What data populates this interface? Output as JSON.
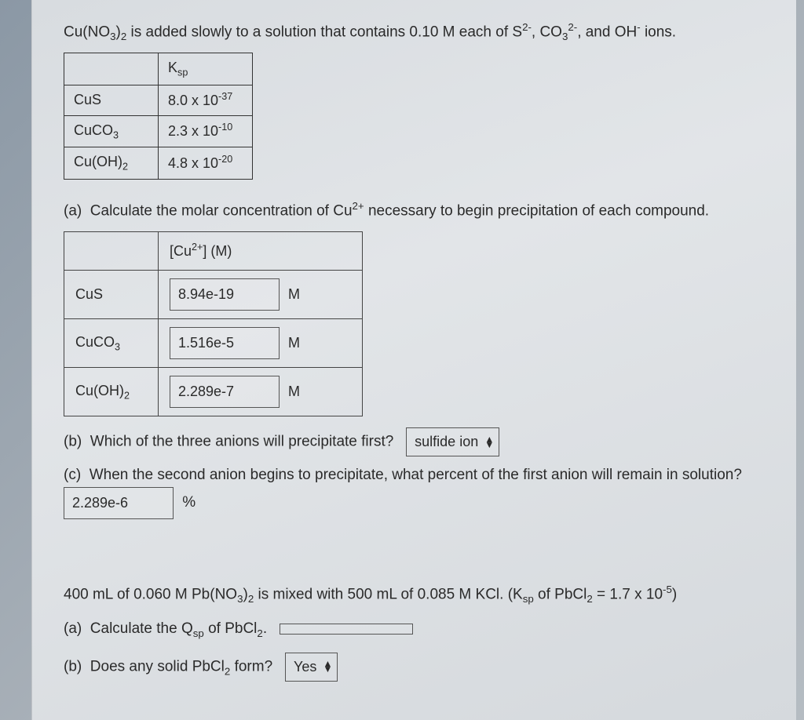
{
  "q1": {
    "intro": "Cu(NO₃)₂ is added slowly to a solution that contains 0.10 M each of S²⁻, CO₃²⁻, and OH⁻ ions.",
    "ksp_header": "Kₛₚ",
    "ksp_table": [
      {
        "compound": "CuS",
        "ksp": "8.0 x 10⁻³⁷"
      },
      {
        "compound": "CuCO₃",
        "ksp": "2.3 x 10⁻¹⁰"
      },
      {
        "compound": "Cu(OH)₂",
        "ksp": "4.8 x 10⁻²⁰"
      }
    ],
    "part_a": {
      "label": "(a)",
      "text": "Calculate the molar concentration of Cu²⁺ necessary to begin precipitation of each compound.",
      "header": "[Cu²⁺] (M)",
      "rows": [
        {
          "compound": "CuS",
          "value": "8.94e-19",
          "unit": "M"
        },
        {
          "compound": "CuCO₃",
          "value": "1.516e-5",
          "unit": "M"
        },
        {
          "compound": "Cu(OH)₂",
          "value": "2.289e-7",
          "unit": "M"
        }
      ]
    },
    "part_b": {
      "label": "(b)",
      "text": "Which of the three anions will precipitate first?",
      "selected": "sulfide ion"
    },
    "part_c": {
      "label": "(c)",
      "text_before": "When the second anion begins to precipitate, what percent of the first anion will remain in solution?",
      "value": "2.289e-6",
      "unit": "%"
    }
  },
  "q2": {
    "intro": "400 mL of 0.060 M Pb(NO₃)₂ is mixed with 500 mL of 0.085 M KCl. (Kₛₚ of PbCl₂ = 1.7 x 10⁻⁵)",
    "part_a": {
      "label": "(a)",
      "text": "Calculate the Qₛₚ of PbCl₂.",
      "value": ""
    },
    "part_b": {
      "label": "(b)",
      "text": "Does any solid PbCl₂ form?",
      "selected": "Yes"
    }
  }
}
